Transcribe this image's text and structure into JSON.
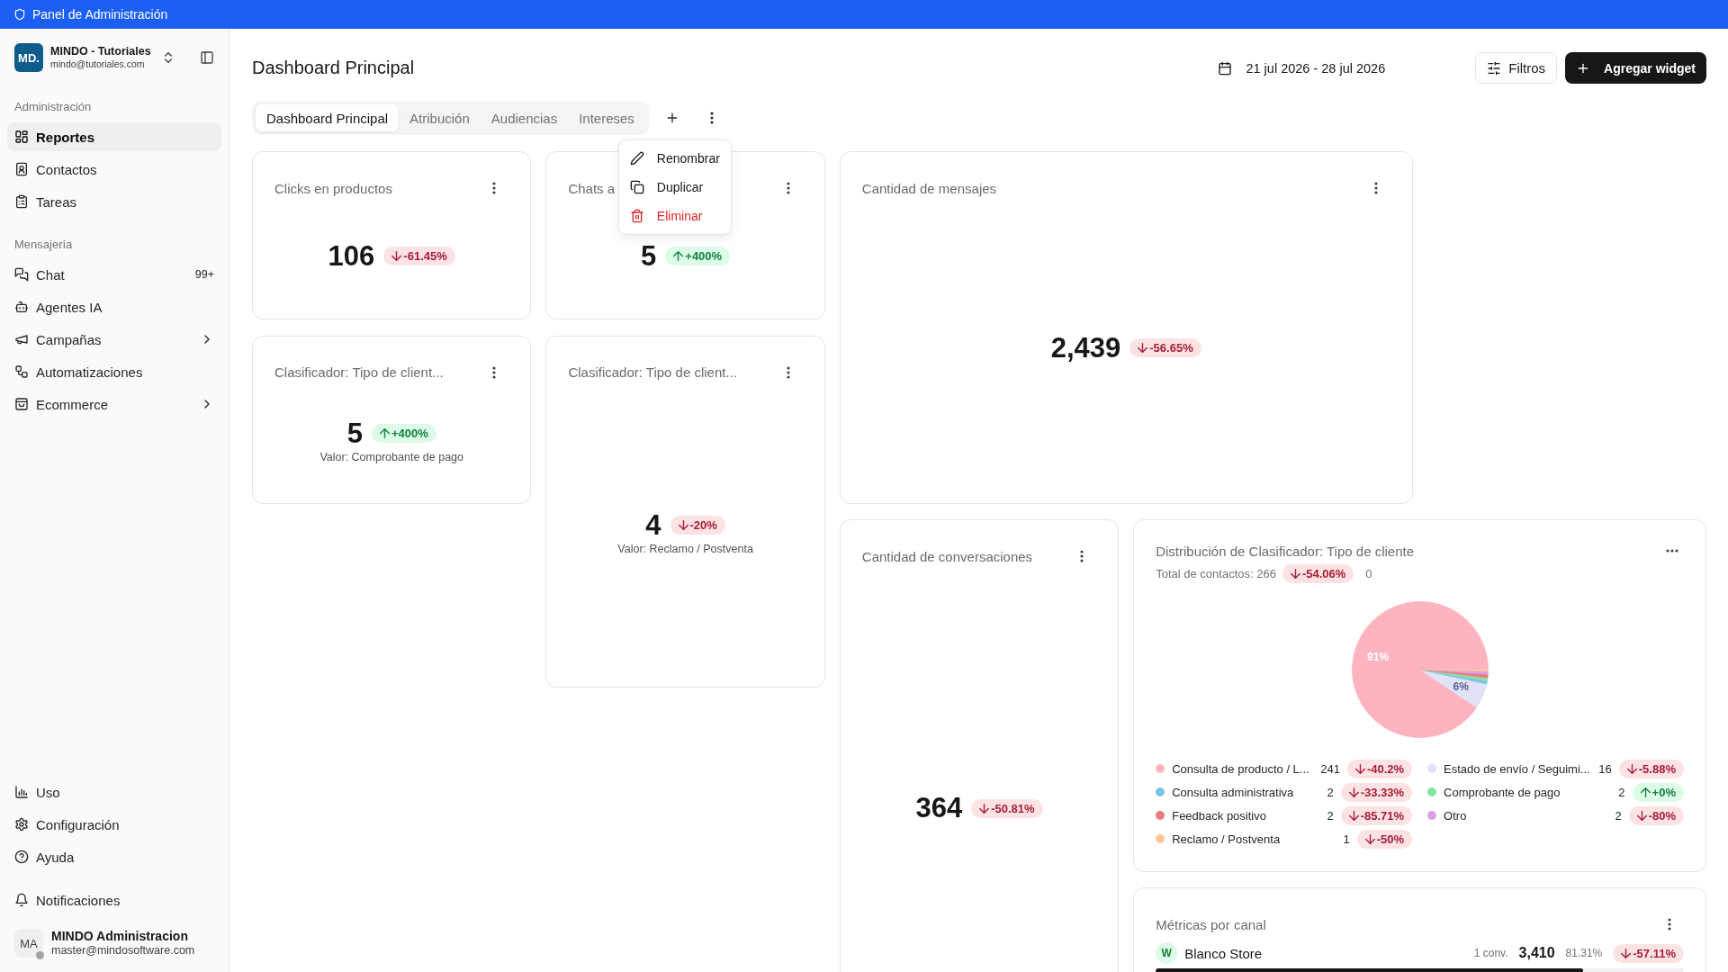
{
  "top_bar": {
    "title": "Panel de Administración"
  },
  "sidebar": {
    "workspace": {
      "logo_text": "MD.",
      "name": "MINDO - Tutoriales",
      "email": "mindo@tutoriales.com"
    },
    "sections": [
      {
        "heading": "Administración",
        "items": [
          {
            "label": "Reportes",
            "kind": "link",
            "selected": true
          },
          {
            "label": "Contactos",
            "kind": "link",
            "selected": false
          },
          {
            "label": "Tareas",
            "kind": "link",
            "selected": false
          }
        ]
      },
      {
        "heading": "Mensajería",
        "items": [
          {
            "label": "Chat",
            "kind": "link",
            "selected": false,
            "badge": "99+"
          },
          {
            "label": "Agentes IA",
            "kind": "link",
            "selected": false
          },
          {
            "label": "Campañas",
            "kind": "group",
            "selected": false
          },
          {
            "label": "Automatizaciones",
            "kind": "link",
            "selected": false
          },
          {
            "label": "Ecommerce",
            "kind": "group",
            "selected": false
          }
        ]
      }
    ],
    "footer_items": [
      {
        "label": "Uso",
        "selected": false
      },
      {
        "label": "Configuración",
        "selected": false
      },
      {
        "label": "Ayuda",
        "selected": false
      }
    ],
    "notifications": {
      "label": "Notificaciones"
    },
    "user": {
      "initials": "MA",
      "name": "MINDO Administracion",
      "email": "master@mindosoftware.com",
      "online": false
    }
  },
  "header": {
    "title": "Dashboard Principal",
    "date_range": "21 jul 2026 - 28 jul 2026",
    "filter_button": "Filtros",
    "add_button": "Agregar widget"
  },
  "tabs": [
    {
      "label": "Dashboard Principal",
      "selected": true
    },
    {
      "label": "Atribución",
      "selected": false
    },
    {
      "label": "Audiencias",
      "selected": false
    },
    {
      "label": "Intereses",
      "selected": false
    }
  ],
  "tab_menu": {
    "open": true,
    "items": [
      {
        "label": "Renombrar",
        "destructive": false
      },
      {
        "label": "Duplicar",
        "destructive": false
      },
      {
        "label": "Eliminar",
        "destructive": true
      }
    ]
  },
  "cards": [
    {
      "kind": "stat",
      "title": "Clicks en productos",
      "value": "106",
      "change": {
        "text": "-61.45%",
        "positive": false
      }
    },
    {
      "kind": "stat",
      "title": "Chats a",
      "value": "5",
      "change": {
        "text": "+400%",
        "positive": true
      }
    },
    {
      "kind": "stat",
      "title": "Cantidad de mensajes",
      "value": "2,439",
      "change": {
        "text": "-56.65%",
        "positive": false
      }
    },
    {
      "kind": "stat",
      "title": "Clasificador: Tipo de client...",
      "value": "5",
      "change": {
        "text": "+400%",
        "positive": true
      },
      "caption": "Valor: Comprobante de pago"
    },
    {
      "kind": "stat",
      "title": "Clasificador: Tipo de client...",
      "value": "4",
      "change": {
        "text": "-20%",
        "positive": false
      },
      "caption": "Valor: Reclamo / Postventa"
    },
    {
      "kind": "stat",
      "title": "Cantidad de conversaciones",
      "value": "364",
      "change": {
        "text": "-50.81%",
        "positive": false
      }
    },
    {
      "kind": "distribution",
      "title": "Distribución de Clasificador: Tipo de cliente",
      "total": "Total de contactos: 266",
      "change": {
        "text": "-54.06%",
        "positive": false
      },
      "extra": "0",
      "chart_data": {
        "type": "pie",
        "categories": [
          "Consulta de producto / L...",
          "Estado de envío / Seguimi...",
          "Consulta administrativa",
          "Comprobante de pago",
          "Feedback positivo",
          "Otro",
          "Reclamo / Postventa"
        ],
        "values": [
          90.6,
          6.0,
          0.75,
          0.75,
          0.75,
          0.75,
          0.38
        ],
        "value_labels": [
          "91%",
          "6%",
          null,
          null,
          null,
          null,
          null
        ]
      },
      "legend": [
        {
          "color": "#fdb4c0",
          "count": "241",
          "change": {
            "text": "-40.2%",
            "positive": false
          }
        },
        {
          "color": "#e0e3f7",
          "count": "16",
          "change": {
            "text": "-5.88%",
            "positive": false
          }
        },
        {
          "color": "#7dc3e8",
          "count": "2",
          "change": {
            "text": "-33.33%",
            "positive": false
          }
        },
        {
          "color": "#86e39c",
          "count": "2",
          "change": {
            "text": "+0%",
            "positive": true
          }
        },
        {
          "color": "#ec7a82",
          "count": "2",
          "change": {
            "text": "-85.71%",
            "positive": false
          }
        },
        {
          "color": "#d9a0e3",
          "count": "2",
          "change": {
            "text": "-80%",
            "positive": false
          }
        },
        {
          "color": "#fcc59b",
          "count": "1",
          "change": {
            "text": "-50%",
            "positive": false
          }
        }
      ]
    },
    {
      "kind": "channels",
      "title": "Métricas por canal",
      "channels": [
        {
          "initial": "W",
          "name": "Blanco Store",
          "conversations": "1 conv.",
          "value": "3,410",
          "share": "81.31%",
          "change": {
            "text": "-57.11%",
            "positive": false
          },
          "level": 0.81
        }
      ]
    }
  ]
}
